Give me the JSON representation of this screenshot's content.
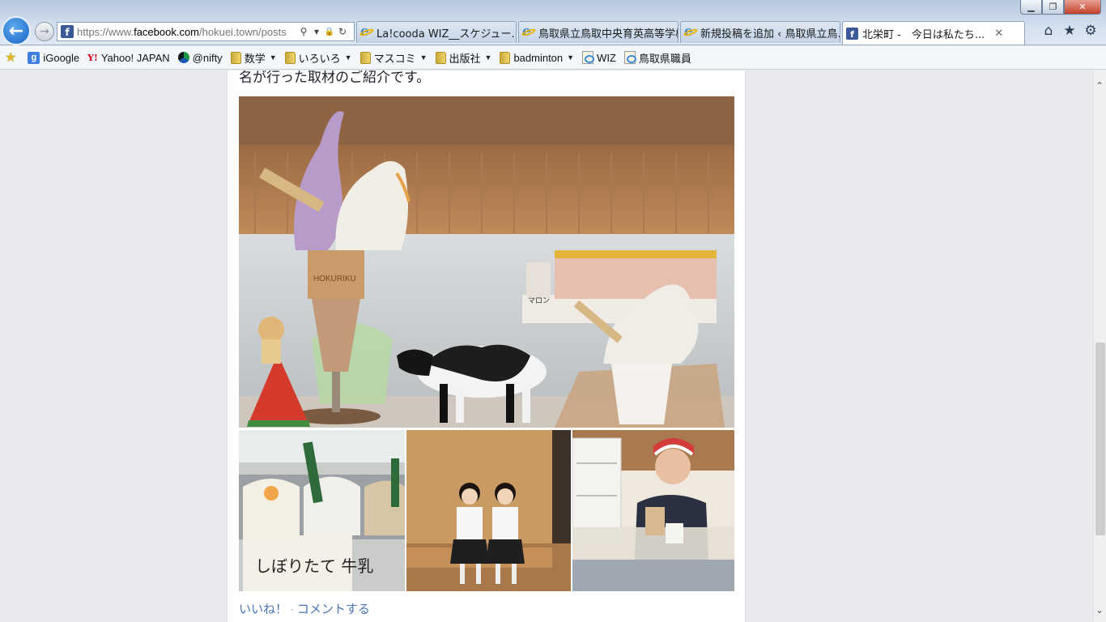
{
  "window": {
    "min_label": "▁",
    "max_label": "❐",
    "close_label": "✕"
  },
  "nav": {
    "back_label": "←",
    "forward_label": "→"
  },
  "address": {
    "favicon": "f",
    "url_prefix": "https://www.",
    "url_domain": "facebook.com",
    "url_rest": "/hokuei.town/posts",
    "search_icon": "⚲",
    "dropdown_icon": "▾",
    "lock_icon": "🔒",
    "refresh_icon": "↻"
  },
  "tabs": [
    {
      "title": "La!cooda WIZ__スケジュー...",
      "icon": "ie",
      "active": false
    },
    {
      "title": "鳥取県立鳥取中央育英高等学校",
      "icon": "ie",
      "active": false
    },
    {
      "title": "新規投稿を追加 ‹ 鳥取県立鳥...",
      "icon": "ie",
      "active": false
    },
    {
      "title": "北栄町 -　今日は私たち...",
      "icon": "facebook",
      "active": true,
      "close": "✕"
    }
  ],
  "toolbar_icons": {
    "home": "⌂",
    "favorites": "★",
    "tools": "⚙"
  },
  "favorites": [
    {
      "label": "",
      "icon": "add-favorite-star"
    },
    {
      "label": "iGoogle",
      "icon": "google"
    },
    {
      "label": "Yahoo! JAPAN",
      "icon": "yahoo"
    },
    {
      "label": "@nifty",
      "icon": "nifty"
    },
    {
      "label": "数学",
      "icon": "folder",
      "dropdown": true
    },
    {
      "label": "いろいろ",
      "icon": "folder",
      "dropdown": true
    },
    {
      "label": "マスコミ",
      "icon": "folder",
      "dropdown": true
    },
    {
      "label": "出版社",
      "icon": "folder",
      "dropdown": true
    },
    {
      "label": "badminton",
      "icon": "folder",
      "dropdown": true
    },
    {
      "label": "WIZ",
      "icon": "ie-page"
    },
    {
      "label": "鳥取県職員",
      "icon": "ie-page"
    }
  ],
  "post": {
    "text": "名が行った取材のご紹介です。",
    "like_label": "いいね！",
    "separator": "·",
    "comment_label": "コメントする",
    "photo_texts": {
      "cone_brand": "HOKURIKU",
      "marron_label": "マロン",
      "sign_text": "しぼりたて 牛乳"
    }
  },
  "scroll": {
    "up": "⌃",
    "down": "⌄"
  }
}
